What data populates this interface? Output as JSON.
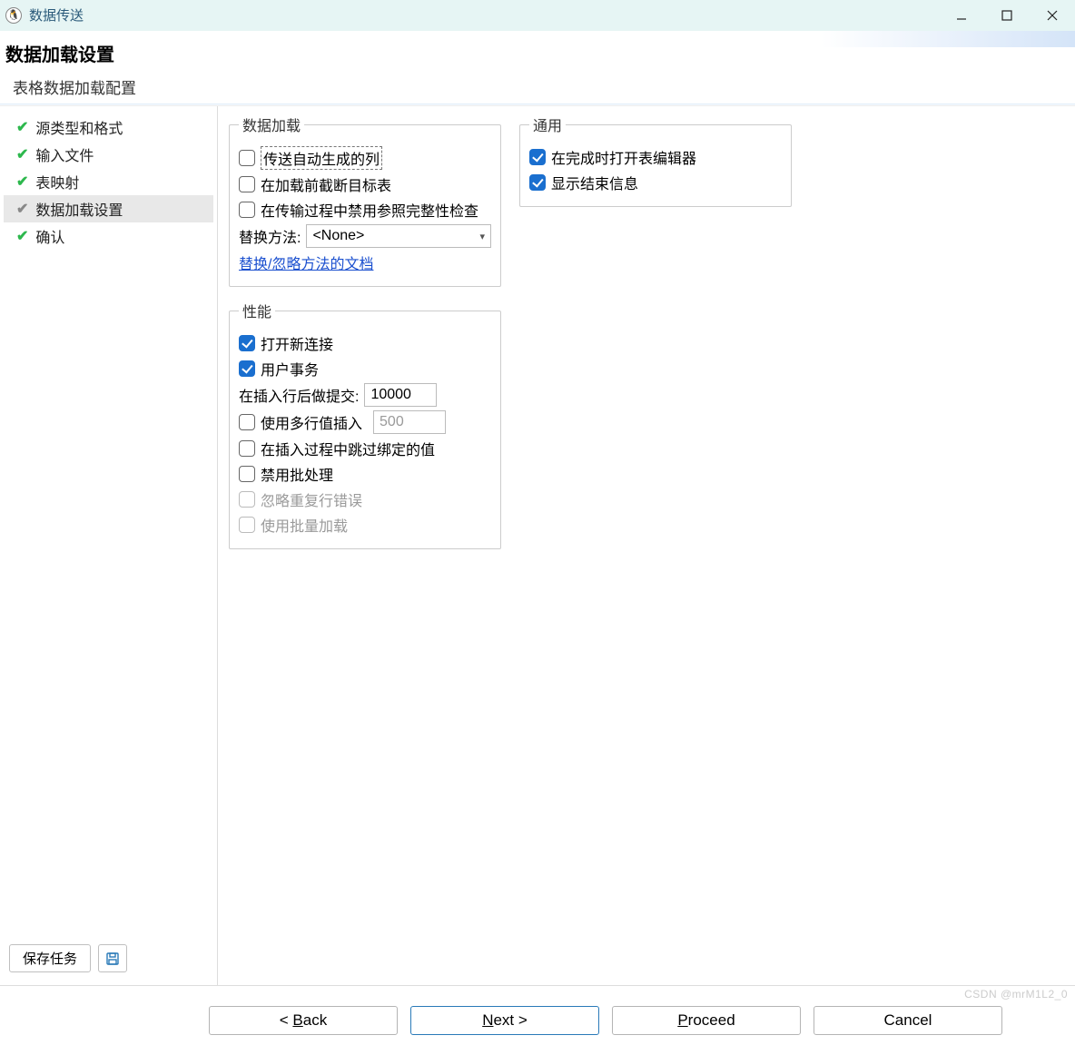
{
  "window": {
    "title": "数据传送"
  },
  "header": {
    "title": "数据加载设置",
    "subtitle": "表格数据加载配置"
  },
  "sidebar": {
    "steps": [
      {
        "label": "源类型和格式",
        "done": true,
        "active": false
      },
      {
        "label": "输入文件",
        "done": true,
        "active": false
      },
      {
        "label": "表映射",
        "done": true,
        "active": false
      },
      {
        "label": "数据加载设置",
        "done": true,
        "active": true
      },
      {
        "label": "确认",
        "done": true,
        "active": false
      }
    ],
    "save_task_label": "保存任务"
  },
  "groups": {
    "data_load": {
      "legend": "数据加载",
      "transfer_auto_cols": {
        "checked": false,
        "label": "传送自动生成的列"
      },
      "truncate_before": {
        "checked": false,
        "label": "在加载前截断目标表"
      },
      "disable_ref_integrity": {
        "checked": false,
        "label": "在传输过程中禁用参照完整性检查"
      },
      "replace_method_label": "替换方法:",
      "replace_method_value": "<None>",
      "replace_doc_link": "替换/忽略方法的文档"
    },
    "performance": {
      "legend": "性能",
      "open_new_conn": {
        "checked": true,
        "label": "打开新连接"
      },
      "user_transaction": {
        "checked": true,
        "label": "用户事务"
      },
      "commit_after_label": "在插入行后做提交:",
      "commit_after_value": "10000",
      "multi_row_insert": {
        "checked": false,
        "label": "使用多行值插入",
        "value": "500"
      },
      "skip_bound_values": {
        "checked": false,
        "label": "在插入过程中跳过绑定的值"
      },
      "disable_batch": {
        "checked": false,
        "label": "禁用批处理"
      },
      "ignore_dup_errors": {
        "checked": false,
        "label": "忽略重复行错误",
        "disabled": true
      },
      "use_bulk_load": {
        "checked": false,
        "label": "使用批量加载",
        "disabled": true
      }
    },
    "general": {
      "legend": "通用",
      "open_editor_on_finish": {
        "checked": true,
        "label": "在完成时打开表编辑器"
      },
      "show_end_info": {
        "checked": true,
        "label": "显示结束信息"
      }
    }
  },
  "footer": {
    "back": "< ",
    "back_letter": "B",
    "back_rest": "ack",
    "next_letter": "N",
    "next_rest": "ext >",
    "proceed_letter": "P",
    "proceed_rest": "roceed",
    "cancel": "Cancel"
  },
  "watermark": "CSDN @mrM1L2_0"
}
